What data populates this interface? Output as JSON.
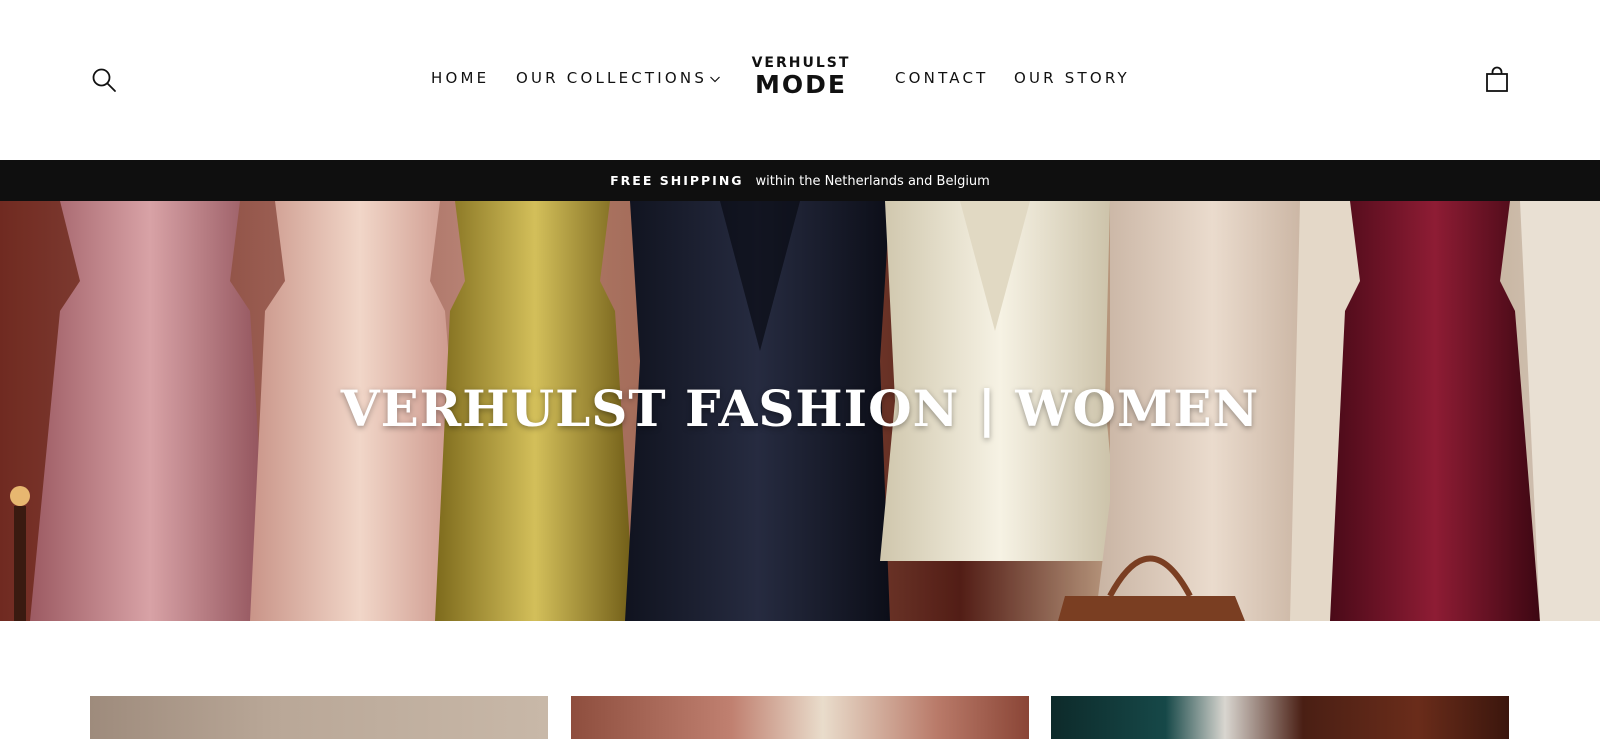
{
  "header": {
    "search_icon": "search-icon",
    "nav": {
      "home": "HOME",
      "collections": "OUR COLLECTIONS",
      "contact": "CONTACT",
      "story": "OUR STORY"
    },
    "logo": {
      "top": "VERHULST",
      "bottom": "MODE"
    },
    "cart_icon": "bag-icon"
  },
  "announcement": {
    "strong": "FREE SHIPPING",
    "text": "within the Netherlands and Belgium"
  },
  "hero": {
    "title": "VERHULST FASHION | WOMEN"
  },
  "colors": {
    "announcement_bg": "#0f0f0f",
    "text": "#111111",
    "hero_text": "#ffffff"
  }
}
